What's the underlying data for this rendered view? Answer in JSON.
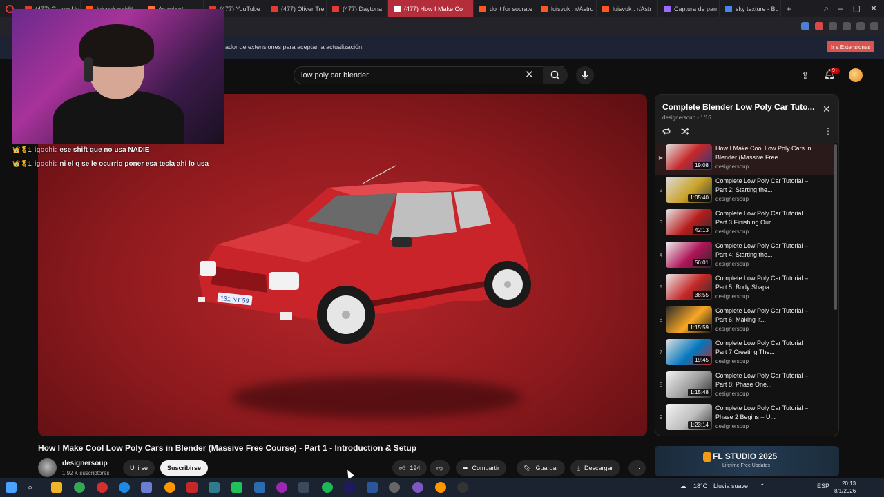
{
  "browser": {
    "tabs": [
      {
        "label": "(477) Grown Up",
        "color": "#e53935"
      },
      {
        "label": "luisvuk reddit",
        "color": "#ff5722"
      },
      {
        "label": "Astrobort",
        "color": "#ff7043"
      },
      {
        "label": "(477) YouTube",
        "color": "#e53935"
      },
      {
        "label": "(477) Oliver Tre",
        "color": "#e53935"
      },
      {
        "label": "(477) Daytona",
        "color": "#e53935"
      },
      {
        "label": "(477) How I Make Co",
        "color": "#e53935",
        "active": true
      },
      {
        "label": "do it for socrate",
        "color": "#ff5722"
      },
      {
        "label": "luisvuk : r/Astro",
        "color": "#ff5722"
      },
      {
        "label": "luisvuk : r/Astr",
        "color": "#ff5722"
      },
      {
        "label": "Captura de pan",
        "color": "#9c6bff"
      },
      {
        "label": "sky texture - Bu",
        "color": "#4285f4"
      }
    ],
    "new_tab_label": "+"
  },
  "notice": {
    "text": "ador de extensiones para aceptar la actualización.",
    "button": "Ir a Extensiones"
  },
  "youtube": {
    "search_value": "low poly car blender",
    "notification_count": "9+"
  },
  "chat": [
    {
      "user": "igochi:",
      "message": "ese shift que no usa NADIE",
      "badges": "👑🎖1"
    },
    {
      "user": "igochi:",
      "message": "ni el q se le ocurrio poner esa tecla ahi lo usa",
      "badges": "👑🎖1"
    }
  ],
  "video": {
    "title": "How I Make Cool Low Poly Cars in Blender (Massive Free Course) - Part 1 - Introduction & Setup",
    "channel": "designersoup",
    "subscribers": "1.92 K suscriptores",
    "join_label": "Unirse",
    "subscribe_label": "Suscribirse",
    "likes": "194",
    "share_label": "Compartir",
    "save_label": "Guardar",
    "download_label": "Descargar",
    "plate_text": "131 NT 59"
  },
  "playlist": {
    "title": "Complete Blender Low Poly Car Tuto...",
    "subtitle": "designersoup - 1/16",
    "items": [
      {
        "index": "▶",
        "title": "How I Make Cool Low Poly Cars in Blender (Massive Free...",
        "channel": "designersoup",
        "duration": "19:08",
        "thumb_color": "#c62828",
        "thumb_text": "NO STEPS"
      },
      {
        "index": "2",
        "title": "Complete Low Poly Car Tutorial – Part 2: Starting the...",
        "channel": "designersoup",
        "duration": "1:05:40",
        "thumb_color": "#c9a227",
        "thumb_text": "THIS SETS E"
      },
      {
        "index": "3",
        "title": "Complete Low Poly Car Tutorial Part 3 Finishing Our...",
        "channel": "designersoup",
        "duration": "42:13",
        "thumb_color": "#b71c1c",
        "thumb_text": "BIG STEP F"
      },
      {
        "index": "4",
        "title": "Complete Low Poly Car Tutorial – Part 4: Starting the...",
        "channel": "designersoup",
        "duration": "56:01",
        "thumb_color": "#ad1457",
        "thumb_text": "FILLING"
      },
      {
        "index": "5",
        "title": "Complete Low Poly Car Tutorial – Part 5: Body Shapa...",
        "channel": "designersoup",
        "duration": "38:55",
        "thumb_color": "#c62828",
        "thumb_text": "CLEAN AN"
      },
      {
        "index": "6",
        "title": "Complete Low Poly Car Tutorial – Part 6: Making It...",
        "channel": "designersoup",
        "duration": "1:15:59",
        "thumb_color": "#f9a825",
        "thumb_text": "ICONIC DE"
      },
      {
        "index": "7",
        "title": "Complete Low Poly Car Tutorial Part 7 Creating The...",
        "channel": "designersoup",
        "duration": "19:45",
        "thumb_color": "#0277bd",
        "thumb_text": "CLEAN DETAI"
      },
      {
        "index": "8",
        "title": "Complete Low Poly Car Tutorial – Part 8: Phase One...",
        "channel": "designersoup",
        "duration": "1:15:48",
        "thumb_color": "#9e9e9e",
        "thumb_text": ""
      },
      {
        "index": "9",
        "title": "Complete Low Poly Car Tutorial – Phase 2 Begins – U...",
        "channel": "designersoup",
        "duration": "1:23:14",
        "thumb_color": "#bdbdbd",
        "thumb_text": "IT'S UNR"
      }
    ]
  },
  "ad": {
    "title": "FL STUDIO 2025",
    "subtitle": "Lifetime Free Updates"
  },
  "taskbar": {
    "temperature": "18°C",
    "weather": "Lluvia suave",
    "language": "ESP",
    "time": "20:13",
    "date": "8/1/2026"
  }
}
